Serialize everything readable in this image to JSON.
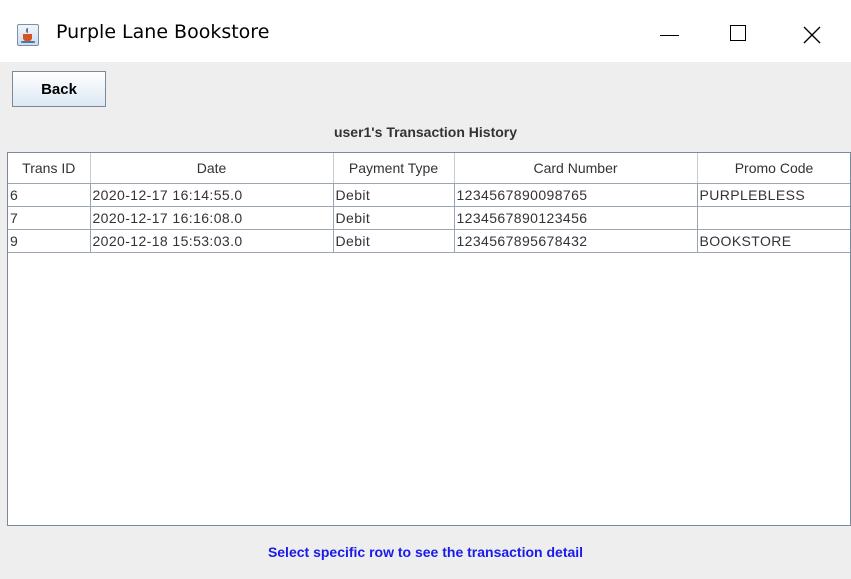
{
  "window": {
    "title": "Purple Lane Bookstore",
    "icon": "java-cup-icon"
  },
  "toolbar": {
    "back_label": "Back"
  },
  "history": {
    "title": "user1's Transaction History",
    "columns": [
      "Trans ID",
      "Date",
      "Payment Type",
      "Card Number",
      "Promo Code"
    ],
    "rows": [
      [
        "6",
        "2020-12-17 16:14:55.0",
        "Debit",
        "1234567890098765",
        "PURPLEBLESS"
      ],
      [
        "7",
        "2020-12-17 16:16:08.0",
        "Debit",
        "1234567890123456",
        ""
      ],
      [
        "9",
        "2020-12-18 15:53:03.0",
        "Debit",
        "1234567895678432",
        "BOOKSTORE"
      ]
    ]
  },
  "footer": {
    "hint": "Select specific row to see the transaction detail",
    "hint_color": "#1a1aeb"
  }
}
